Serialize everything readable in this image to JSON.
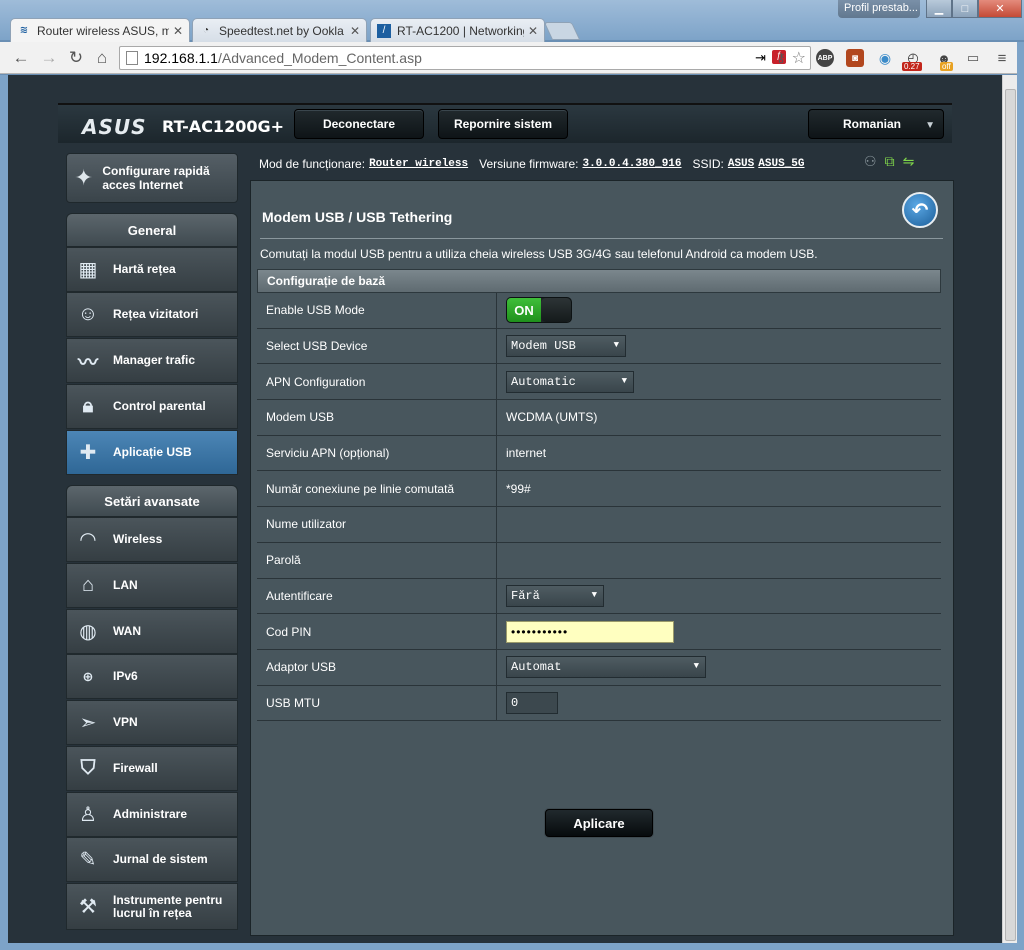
{
  "browser": {
    "tabs": [
      {
        "label": "Router wireless ASUS, mo",
        "active": true
      },
      {
        "label": "Speedtest.net by Ookla - T",
        "active": false
      },
      {
        "label": "RT-AC1200 | Networking |",
        "active": false
      }
    ],
    "profile": "Profil prestab...",
    "url_host": "192.168.1.1",
    "url_path": "/Advanced_Modem_Content.asp",
    "extensions": [
      {
        "name": "abp",
        "text": "ABP"
      },
      {
        "name": "badge-count",
        "text": "0.27"
      },
      {
        "name": "off-badge",
        "text": "off"
      }
    ]
  },
  "router": {
    "logo": "ASUS",
    "model": "RT-AC1200G+",
    "header_buttons": {
      "logout": "Deconectare",
      "reboot": "Repornire sistem",
      "language": "Romanian"
    },
    "status": {
      "mode_label": "Mod de funcționare:",
      "mode_value": "Router wireless",
      "firmware_label": "Versiune firmware:",
      "firmware_value": "3.0.0.4.380_916",
      "ssid_label": "SSID:",
      "ssid_1": "ASUS",
      "ssid_2": "ASUS_5G"
    }
  },
  "sidebar": {
    "quick_setup": "Configurare rapidă acces Internet",
    "general_title": "General",
    "general_items": [
      {
        "label": "Hartă rețea",
        "icon": "network-map-icon"
      },
      {
        "label": "Rețea vizitatori",
        "icon": "guest-network-icon"
      },
      {
        "label": "Manager trafic",
        "icon": "traffic-manager-icon"
      },
      {
        "label": "Control parental",
        "icon": "parental-control-icon"
      },
      {
        "label": "Aplicație USB",
        "icon": "usb-app-icon",
        "active": true
      }
    ],
    "advanced_title": "Setări avansate",
    "advanced_items": [
      {
        "label": "Wireless",
        "icon": "wireless-icon"
      },
      {
        "label": "LAN",
        "icon": "lan-icon"
      },
      {
        "label": "WAN",
        "icon": "wan-icon"
      },
      {
        "label": "IPv6",
        "icon": "ipv6-icon"
      },
      {
        "label": "VPN",
        "icon": "vpn-icon"
      },
      {
        "label": "Firewall",
        "icon": "firewall-icon"
      },
      {
        "label": "Administrare",
        "icon": "administration-icon"
      },
      {
        "label": "Jurnal de sistem",
        "icon": "system-log-icon"
      },
      {
        "label": "Instrumente pentru lucrul în rețea",
        "icon": "network-tools-icon"
      }
    ]
  },
  "main": {
    "title": "Modem USB / USB Tethering",
    "description": "Comutați la modul USB pentru a utiliza cheia wireless USB 3G/4G sau telefonul Android ca modem USB.",
    "section_title": "Configurație de bază",
    "rows": {
      "enable_usb_mode": {
        "label": "Enable USB Mode",
        "value": "ON"
      },
      "select_usb_device": {
        "label": "Select USB Device",
        "value": "Modem USB"
      },
      "apn_configuration": {
        "label": "APN Configuration",
        "value": "Automatic"
      },
      "modem_usb": {
        "label": "Modem USB",
        "value": "WCDMA (UMTS)"
      },
      "apn_service": {
        "label": "Serviciu APN (opțional)",
        "value": "internet"
      },
      "dial_number": {
        "label": "Număr conexiune pe linie comutată",
        "value": "*99#"
      },
      "username": {
        "label": "Nume utilizator",
        "value": ""
      },
      "password": {
        "label": "Parolă",
        "value": ""
      },
      "authentication": {
        "label": "Autentificare",
        "value": "Fără"
      },
      "pin_code": {
        "label": "Cod PIN",
        "value": "•••••••••••"
      },
      "usb_adapter": {
        "label": "Adaptor USB",
        "value": "Automat"
      },
      "usb_mtu": {
        "label": "USB MTU",
        "value": "0"
      }
    },
    "apply_button": "Aplicare"
  }
}
